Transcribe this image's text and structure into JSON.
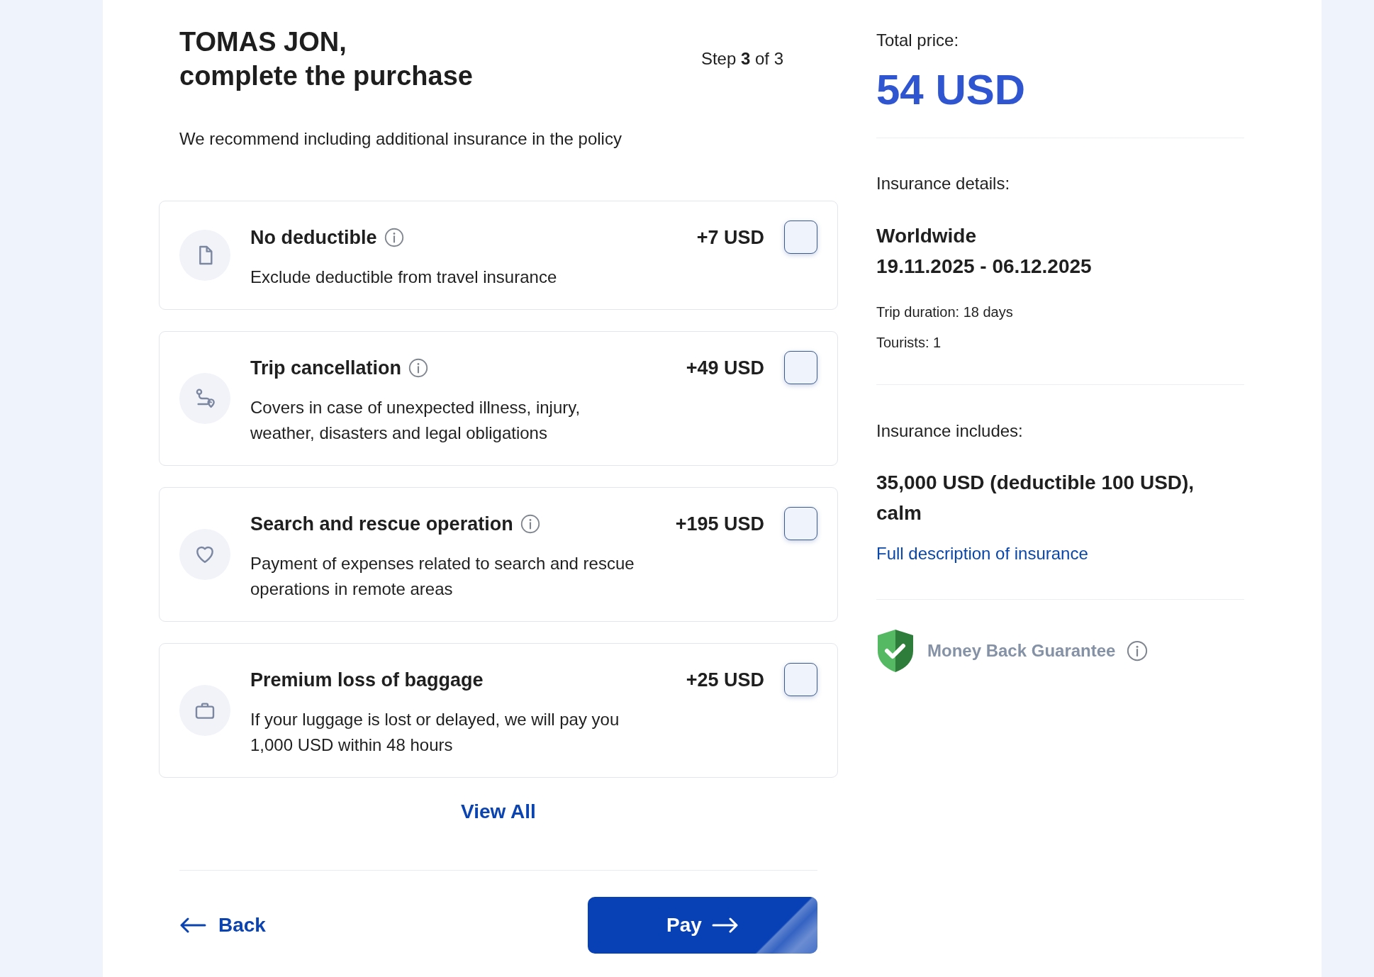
{
  "header": {
    "title_lines": [
      "TOMAS JON,",
      "complete the purchase"
    ],
    "step": "Step **3** of 3",
    "subtitle": "We recommend including additional insurance in the policy"
  },
  "options": [
    {
      "title": "No deductible",
      "has_info": true,
      "price": "+7 USD",
      "description": "Exclude deductible from travel insurance",
      "checked": false
    },
    {
      "title": "Trip cancellation",
      "has_info": true,
      "price": "+49 USD",
      "description": "Covers in case of unexpected illness, injury, weather, disasters and legal obligations",
      "checked": false
    },
    {
      "title": "Search and rescue operation",
      "has_info": true,
      "price": "+195 USD",
      "description": "Payment of expenses related to search and rescue operations in remote areas",
      "checked": false
    },
    {
      "title": "Premium loss of baggage",
      "has_info": false,
      "price": "+25 USD",
      "description": "If your luggage is lost or delayed, we will pay you 1,000 USD within 48 hours",
      "checked": false
    }
  ],
  "view_all": "View All",
  "actions": {
    "back": "Back",
    "pay": "Pay"
  },
  "summary": {
    "total_label": "Total price:",
    "total_amount": "54 USD",
    "details_label": "Insurance details:",
    "region": "Worldwide",
    "dates": "19.11.2025 - 06.12.2025",
    "facts": [
      "Trip duration: 18 days",
      "Tourists: 1"
    ],
    "includes_label": "Insurance includes:",
    "coverage": "35,000 USD (deductible 100 USD), calm",
    "link": "Full description of insurance",
    "guarantee": "Money Back Guarantee"
  }
}
